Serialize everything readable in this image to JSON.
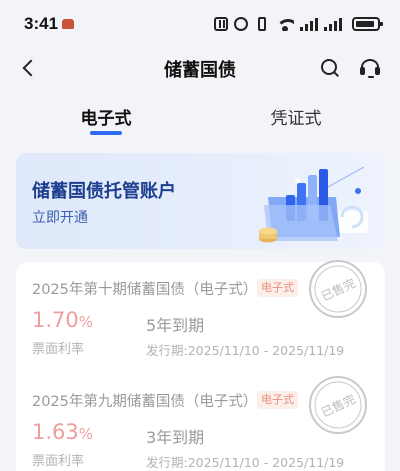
{
  "status_bar": {
    "time": "3:41",
    "icons": [
      "app-notification-icon",
      "nfc-icon",
      "alarm-icon",
      "vibrate-icon",
      "wifi-icon",
      "signal-icon",
      "signal-icon",
      "battery-charging-icon"
    ]
  },
  "header": {
    "title": "储蓄国债",
    "back_icon": "chevron-left-icon",
    "search_icon": "search-icon",
    "service_icon": "customer-service-icon"
  },
  "tabs": [
    {
      "label": "电子式",
      "selected": true
    },
    {
      "label": "凭证式",
      "selected": false
    }
  ],
  "banner": {
    "title": "储蓄国债托管账户",
    "subtitle": "立即开通",
    "art_icon": "bar-chart-folder-illustration"
  },
  "bonds": [
    {
      "name": "2025年第十期储蓄国债（电子式）",
      "tag": "电子式",
      "rate_value": "1.70",
      "rate_unit": "%",
      "rate_label": "票面利率",
      "term": "5年到期",
      "period": "发行期:2025/11/10 - 2025/11/19",
      "stamp": "已售完"
    },
    {
      "name": "2025年第九期储蓄国债（电子式）",
      "tag": "电子式",
      "rate_value": "1.63",
      "rate_unit": "%",
      "rate_label": "票面利率",
      "term": "3年到期",
      "period": "发行期:2025/11/10 - 2025/11/19",
      "stamp": "已售完"
    }
  ],
  "colors": {
    "accent": "#2f6bf2",
    "rate": "#ef9e9e",
    "tag_text": "#e8907c",
    "tag_bg": "#fdeeea",
    "banner_title": "#1e3f8f"
  }
}
